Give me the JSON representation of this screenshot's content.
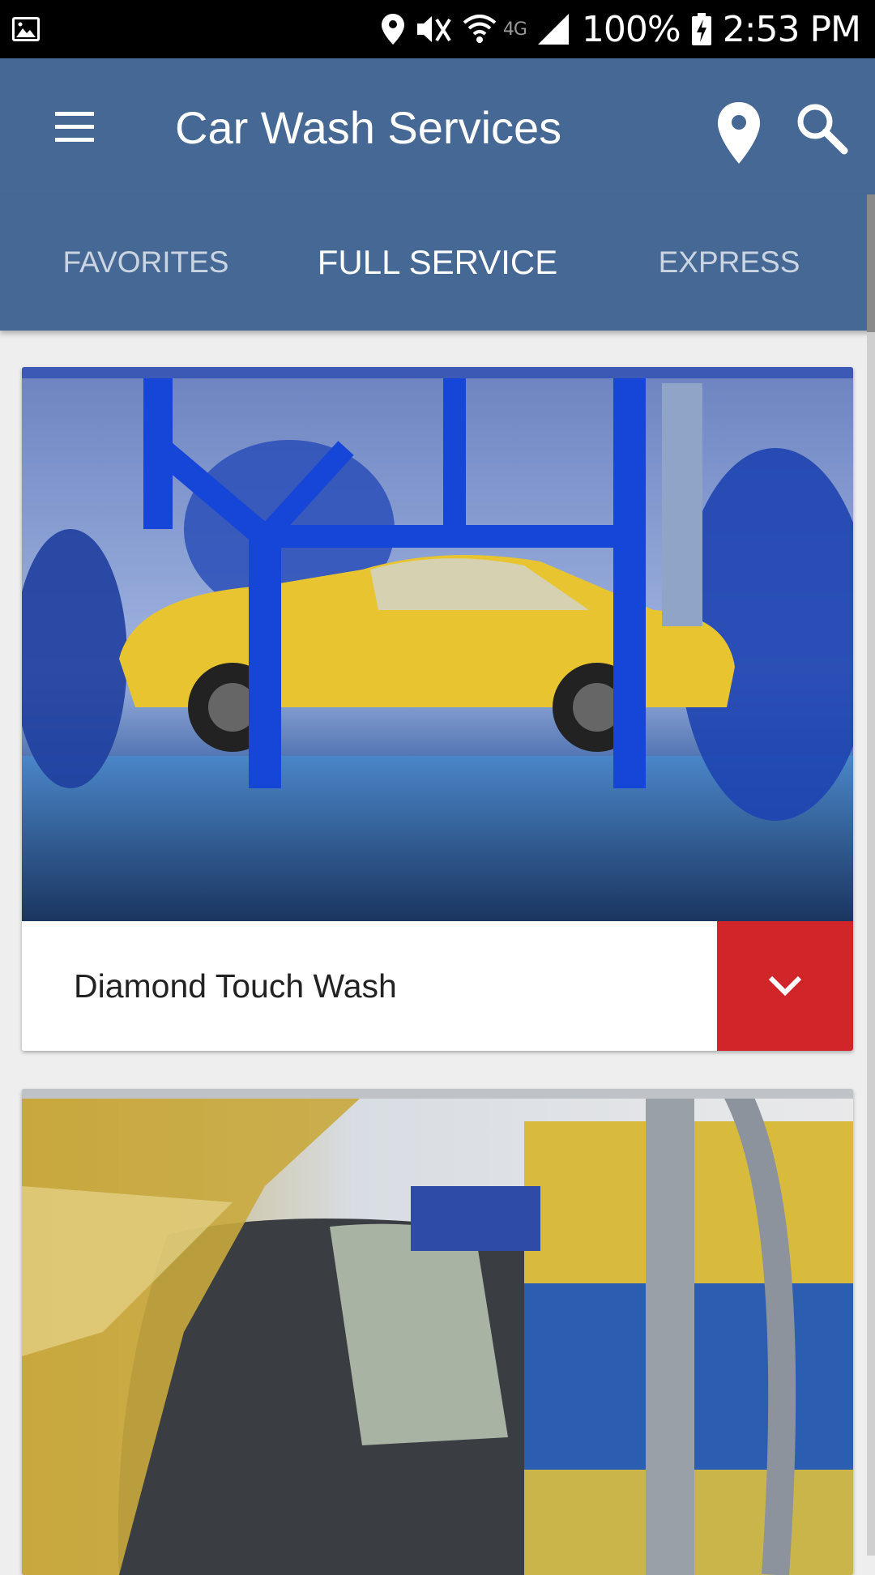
{
  "status_bar": {
    "battery": "100%",
    "time": "2:53 PM",
    "network": "4G",
    "icons": [
      "gallery-icon",
      "location-icon",
      "mute-icon",
      "wifi-icon",
      "signal-icon",
      "battery-charging-icon"
    ]
  },
  "app_bar": {
    "title": "Car Wash Services",
    "icons": [
      "menu-icon",
      "map-pin-icon",
      "search-icon"
    ],
    "background": "#466894"
  },
  "tabs": [
    {
      "label": "FAVORITES",
      "active": false
    },
    {
      "label": "FULL SERVICE",
      "active": true
    },
    {
      "label": "EXPRESS",
      "active": false
    }
  ],
  "cards": [
    {
      "name": "Diamond Touch Wash",
      "image": "yellow car in blue brush car wash tunnel",
      "expand_icon": "chevron-down-icon"
    },
    {
      "name": "",
      "image": "car wash brushes spinning around car",
      "expand_icon": ""
    }
  ],
  "colors": {
    "accent": "#d0262a",
    "primary": "#466894"
  }
}
